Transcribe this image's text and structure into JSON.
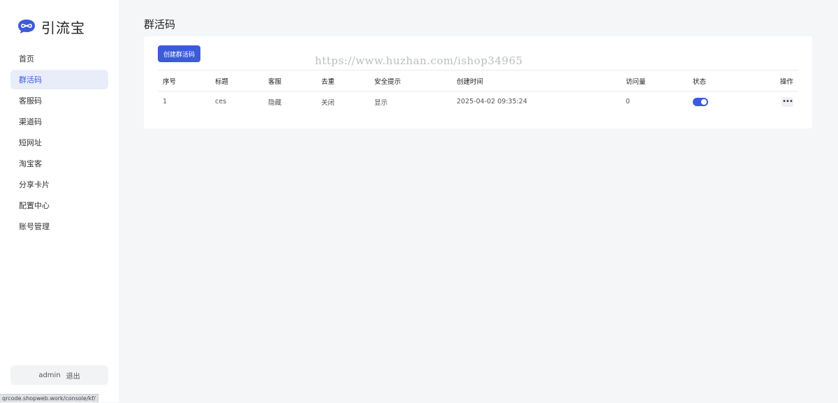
{
  "app": {
    "name": "引流宝"
  },
  "sidebar": {
    "items": [
      {
        "label": "首页"
      },
      {
        "label": "群活码",
        "active": true
      },
      {
        "label": "客服码"
      },
      {
        "label": "渠道码"
      },
      {
        "label": "短网址"
      },
      {
        "label": "淘宝客"
      },
      {
        "label": "分享卡片"
      },
      {
        "label": "配置中心"
      },
      {
        "label": "账号管理"
      }
    ],
    "user": "admin",
    "logout": "退出"
  },
  "status_url": "qrcode.shopweb.work/console/kf/",
  "main": {
    "title": "群活码",
    "create_button": "创建群活码",
    "watermark": "https://www.huzhan.com/ishop34965",
    "table": {
      "headers": [
        "序号",
        "标题",
        "客服",
        "去重",
        "安全提示",
        "创建时间",
        "访问量",
        "状态",
        "操作"
      ],
      "rows": [
        {
          "no": "1",
          "title": "ces",
          "kf": "隐藏",
          "dedup": "关闭",
          "safety": "显示",
          "created": "2025-04-02 09:35:24",
          "visits": "0",
          "status_on": true
        }
      ]
    }
  },
  "colors": {
    "accent": "#3b5bdb",
    "active_bg": "#e8edf9"
  },
  "icons": {
    "logo": "chat-bubble-infinity-icon",
    "more": "more-dots-icon"
  }
}
